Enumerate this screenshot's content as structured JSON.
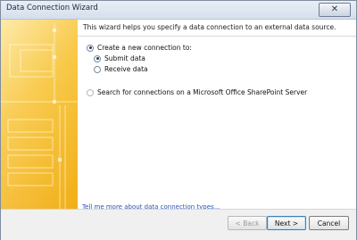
{
  "window": {
    "title": "Data Connection Wizard",
    "close_glyph": "✕"
  },
  "intro": "This wizard helps you specify a data connection to an external data source.",
  "options": {
    "create_new": "Create a new connection to:",
    "submit": "Submit data",
    "receive": "Receive data",
    "search_sharepoint": "Search for connections on a Microsoft Office SharePoint Server"
  },
  "link": "Tell me more about data connection types...",
  "buttons": {
    "back": "< Back",
    "next": "Next >",
    "cancel": "Cancel"
  },
  "colors": {
    "accent": "#f5b820",
    "link": "#2955b8"
  }
}
